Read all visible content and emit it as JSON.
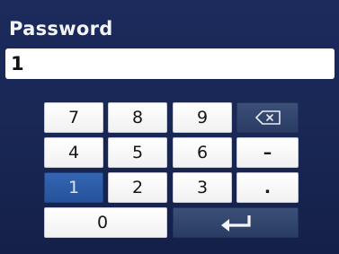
{
  "dialog": {
    "title": "Password",
    "password_value": "1"
  },
  "keypad": {
    "rows": [
      [
        "7",
        "8",
        "9",
        "backspace"
      ],
      [
        "4",
        "5",
        "6",
        "-"
      ],
      [
        "1",
        "2",
        "3",
        "."
      ],
      [
        "0",
        "enter"
      ]
    ],
    "labels": {
      "k7": "7",
      "k8": "8",
      "k9": "9",
      "k4": "4",
      "k5": "5",
      "k6": "6",
      "minus": "–",
      "k1": "1",
      "k2": "2",
      "k3": "3",
      "dot": ".",
      "k0": "0"
    },
    "active_key": "1",
    "icons": {
      "backspace": "backspace-icon",
      "enter": "enter-icon"
    }
  },
  "colors": {
    "background": "#1a2856",
    "key_face": "#ffffff",
    "active_key": "#2f5fab",
    "function_key": "#33466e"
  }
}
